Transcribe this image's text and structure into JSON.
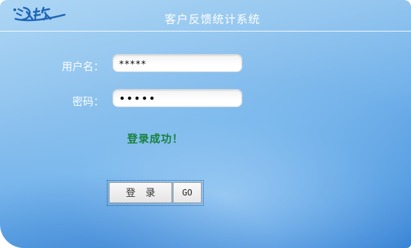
{
  "header": {
    "logo_text": "汉软",
    "title": "客户反馈统计系统"
  },
  "form": {
    "username_label": "用户名：",
    "username_value": "*****",
    "password_label": "密码：",
    "password_value": "12345"
  },
  "status": {
    "message": "登录成功！",
    "color": "#16803a"
  },
  "buttons": {
    "login_label": "登录",
    "go_label": "GO"
  },
  "colors": {
    "background_light": "#aed6f4",
    "background_dark": "#2f7ad1",
    "logo": "#1f66b7"
  }
}
